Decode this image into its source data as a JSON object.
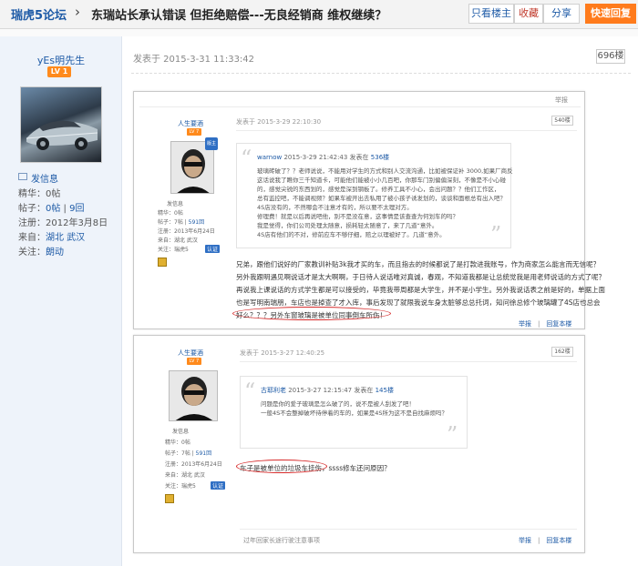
{
  "header": {
    "forum_name": "瑞虎5论坛",
    "chevron": "›",
    "thread_title": "东瑞站长承认错误 但拒绝赔偿---无良经销商 维权继续？",
    "btn_owner_only": "只看楼主",
    "btn_favorite": "收藏",
    "btn_share": "分享",
    "btn_quick_reply": "快速回复"
  },
  "user": {
    "name": "yEs明先生",
    "level": "LV 1",
    "send_message": "发信息",
    "essence_label": "精华：",
    "essence_value": "0帖",
    "posts_label": "帖子：",
    "posts_value": "0帖",
    "posts_sep": " | ",
    "replies_value": "9回",
    "registered_label": "注册：",
    "registered_value": "2012年3月8日",
    "from_label": "来自：",
    "from_value": "湖北 武汉",
    "follow_label": "关注：",
    "follow_value": "朗动"
  },
  "post": {
    "meta": "发表于 2015-3-31 11:33:42",
    "floor": "696楼"
  },
  "shot1": {
    "top_links": "举报",
    "user_name": "人生要酒",
    "level": "LV 7",
    "badge": "版主",
    "send_message": "发信息",
    "essence": "精华：0帖",
    "posts": "帖子：7帖",
    "posts_sep": " | ",
    "replies": "591回",
    "registered": "注册：2013年6月24日",
    "from": "来自：湖北 武汉",
    "follow_label": "关注：瑞虎5",
    "certified": "认证",
    "meta": "发表于 2015-3-29 22:10:30",
    "floor": "540楼",
    "quote_author": "warnow",
    "quote_time": " 2015-3-29 21:42:43 发表在 ",
    "quote_floor": "536楼",
    "quote_lines": [
      "玻璃砖破了？？老师说说，不能用对学生的方式和别人交流沟通，比如被保证补 3000,如果厂商反",
      "这话说我了瞧你三千知道卡，可能他们能被小小几百吧，你那车门别偏偏深刻，不像是不小心碰",
      "的，感觉尖锐的东西划的，感觉是深到钢板了。修养工具不小心，会出问题？？他们工作区，",
      "总有监控吧，不能调视频？如果车被开出去私用了被小孩子诱发划的，谈谈和面根总有出入吧？",
      "4S店没有的，不然哪会不注意才有的，所以要不太理对方。",
      "修理费！就是以后再说吧他，别不是没在意，这事情是该查查为何划车的吗？",
      "我是觉得，你们公司处理太随意，损耗轻太随意了，来了几道“意外。",
      "4S店有他们的不对，修前应车不够仔细，赔之以理被好了。几道“意外。"
    ],
    "body_lines": [
      "兄弟，跟他们说好的厂家教训补贴3k我才买的车，而且指去的时候都说了是打款进我账号，作为商家怎么能言而无信呢？",
      "另外我跟明遇见啊说话才是太大啊啊，于日待人说话唯对真诚，春观，不知道我都是让总统觉我是用老师说话的方式了呢？",
      "再说我上课说话的方式学生都是可以接受的，毕竟我带周都是大学生，并不是小学生。另外我说话表之前是好的，单据上面",
      "也是写明南瑞朋，车店也是掉查了才入库，事后发现了就限我说车身太脏够总总托词，知问徐总修个玻璃罐了4S店也总会",
      "好么？？？另外车窗玻璃是被单位同事倒车所伤！"
    ],
    "foot_report": "举报",
    "foot_reply": "回复本楼"
  },
  "shot2": {
    "user_name": "人生要酒",
    "level": "LV 7",
    "send_message": "发信息",
    "essence": "精华：0帖",
    "posts": "帖子：7帖",
    "posts_sep": " | ",
    "replies": "591回",
    "registered": "注册：2013年6月24日",
    "from": "来自：湖北 武汉",
    "follow_label": "关注：瑞虎5",
    "certified": "认证",
    "meta": "发表于 2015-3-27 12:40:25",
    "floor": "162楼",
    "quote_author": "古耶利老",
    "quote_time": " 2015-3-27 12:15:47 发表在 ",
    "quote_floor": "145楼",
    "quote_lines": [
      "问题是你的爱子玻璃是怎么破了的，说不是被人刮发了吧！",
      "一般4S不会整掉破坏待停着的车的，如果是4S所为这不是自找麻烦吗？"
    ],
    "body_highlight": "车子是被单位的垃圾车挂伤",
    "body_rest": "，ssss修车还问原因？",
    "foot_left": "过年回家长途行驶注意事项",
    "foot_report": "举报",
    "foot_reply": "回复本楼"
  }
}
